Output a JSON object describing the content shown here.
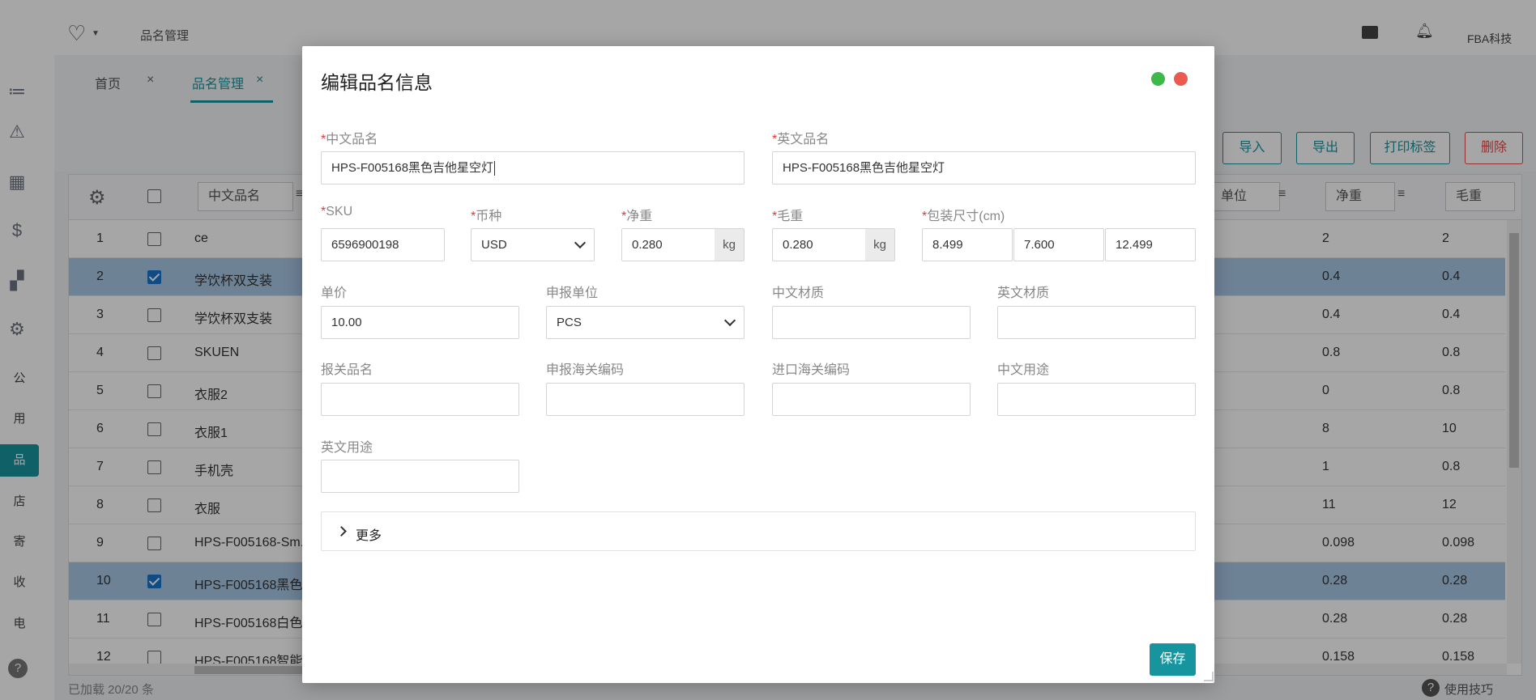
{
  "header": {
    "breadcrumb": "品名管理",
    "company": "FBA科技"
  },
  "sidebar": {
    "items": [
      "公",
      "用",
      "品",
      "店",
      "寄",
      "收",
      "电"
    ],
    "active_index": 2
  },
  "tabs": [
    {
      "label": "首页",
      "close": "×"
    },
    {
      "label": "品名管理",
      "close": "×"
    }
  ],
  "toolbar": {
    "import": "导入",
    "export": "导出",
    "print_label": "打印标签",
    "delete": "删除"
  },
  "table": {
    "columns": {
      "cn_name": "中文品名",
      "unit": "单位",
      "net_weight": "净重",
      "gross_weight": "毛重",
      "menu_glyph": "≡"
    },
    "rows": [
      {
        "no": "1",
        "name": "ce",
        "net": "2",
        "gross": "2",
        "checked": false
      },
      {
        "no": "2",
        "name": "学饮杯双支装",
        "net": "0.4",
        "gross": "0.4",
        "checked": true
      },
      {
        "no": "3",
        "name": "学饮杯双支装",
        "net": "0.4",
        "gross": "0.4",
        "checked": false
      },
      {
        "no": "4",
        "name": "SKUEN",
        "net": "0.8",
        "gross": "0.8",
        "checked": false
      },
      {
        "no": "5",
        "name": "衣服2",
        "net": "0",
        "gross": "0.8",
        "checked": false
      },
      {
        "no": "6",
        "name": "衣服1",
        "net": "8",
        "gross": "10",
        "checked": false
      },
      {
        "no": "7",
        "name": "手机壳",
        "net": "1",
        "gross": "0.8",
        "checked": false
      },
      {
        "no": "8",
        "name": "衣服",
        "net": "11",
        "gross": "12",
        "checked": false
      },
      {
        "no": "9",
        "name": "HPS-F005168-Sm...",
        "net": "0.098",
        "gross": "0.098",
        "checked": false
      },
      {
        "no": "10",
        "name": "HPS-F005168黑色...",
        "net": "0.28",
        "gross": "0.28",
        "checked": true
      },
      {
        "no": "11",
        "name": "HPS-F005168白色...",
        "net": "0.28",
        "gross": "0.28",
        "checked": false
      },
      {
        "no": "12",
        "name": "HPS-F005168智能...",
        "net": "0.158",
        "gross": "0.158",
        "checked": false
      }
    ]
  },
  "status": {
    "loaded": "已加载 20/20 条",
    "help": "使用技巧"
  },
  "modal": {
    "title": "编辑品名信息",
    "required_mark": "*",
    "cn_name": {
      "label": "中文品名",
      "value": "HPS-F005168黑色吉他星空灯"
    },
    "en_name": {
      "label": "英文品名",
      "value": "HPS-F005168黑色吉他星空灯"
    },
    "sku": {
      "label": "SKU",
      "value": "6596900198"
    },
    "currency": {
      "label": "币种",
      "value": "USD"
    },
    "net_weight": {
      "label": "净重",
      "value": "0.280",
      "unit": "kg"
    },
    "gross_weight": {
      "label": "毛重",
      "value": "0.280",
      "unit": "kg"
    },
    "package_size": {
      "label": "包装尺寸(cm)",
      "length": "8.499",
      "width": "7.600",
      "height": "12.499"
    },
    "unit_price": {
      "label": "单价",
      "value": "10.00"
    },
    "declare_unit": {
      "label": "申报单位",
      "value": "PCS"
    },
    "cn_material": {
      "label": "中文材质",
      "value": ""
    },
    "en_material": {
      "label": "英文材质",
      "value": ""
    },
    "customs_name": {
      "label": "报关品名",
      "value": ""
    },
    "declare_hs_code": {
      "label": "申报海关编码",
      "value": ""
    },
    "import_hs_code": {
      "label": "进口海关编码",
      "value": ""
    },
    "cn_usage": {
      "label": "中文用途",
      "value": ""
    },
    "en_usage": {
      "label": "英文用途",
      "value": ""
    },
    "more": "更多",
    "save": "保存"
  },
  "colors": {
    "primary": "#17959e",
    "danger": "#e04b4b",
    "selected_row": "#a9c8e6",
    "required": "#e53935",
    "window_green": "#3cb94a",
    "window_red": "#ec5a4f"
  }
}
